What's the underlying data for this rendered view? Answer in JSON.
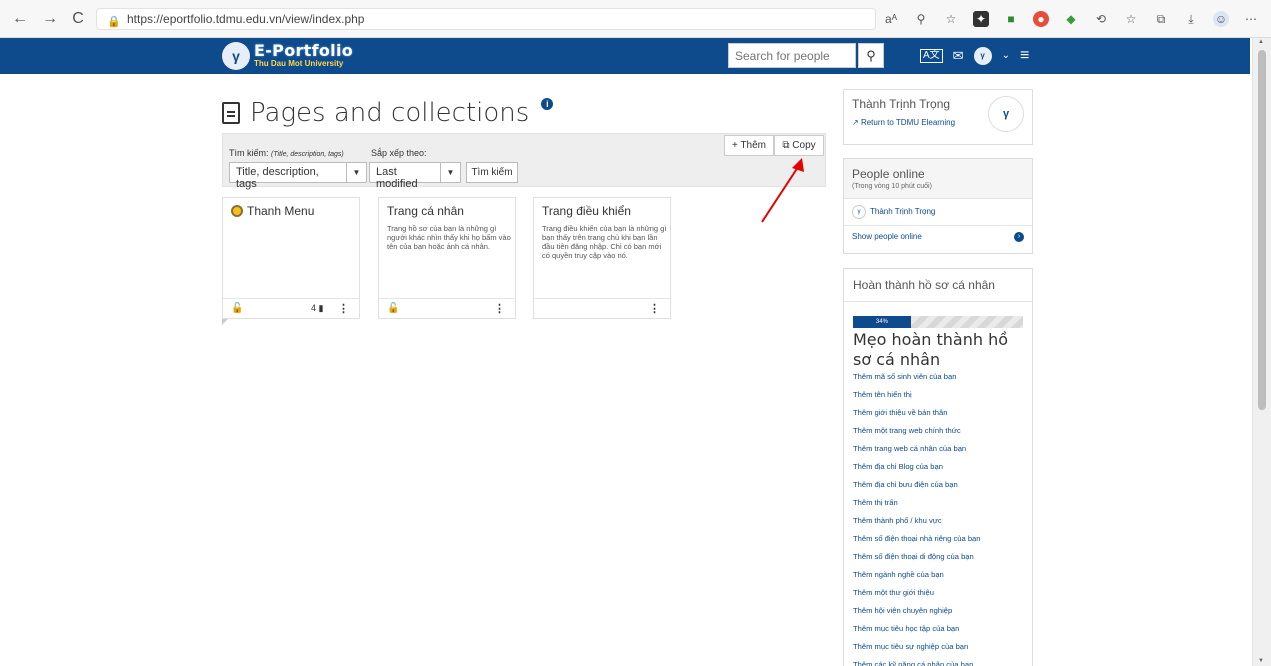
{
  "browser": {
    "url": "https://eportfolio.tdmu.edu.vn/view/index.php",
    "back": "←",
    "forward": "→",
    "reload": "C"
  },
  "header": {
    "logo_title": "E-Portfolio",
    "logo_subtitle": "Thu Dau Mot University",
    "search_placeholder": "Search for people",
    "search_icon": "search-icon"
  },
  "main": {
    "title": "Pages and collections",
    "filter": {
      "search_label": "Tìm kiếm:",
      "search_hint": "(Title, description, tags)",
      "sort_label": "Sắp xếp theo:",
      "search_select": "Title, description, tags",
      "sort_select": "Last modified",
      "find_button": "Tìm kiếm",
      "add_button": "+ Thêm",
      "copy_button": "Copy"
    },
    "cards": [
      {
        "title": "Thanh Menu",
        "description": "",
        "count": "4",
        "has_lock": true
      },
      {
        "title": "Trang cá nhân",
        "description": "Trang hồ sơ của bạn là những gì người khác nhìn thấy khi họ bấm vào tên của bạn hoặc ảnh cá nhân.",
        "count": "",
        "has_lock": true
      },
      {
        "title": "Trang điều khiển",
        "description": "Trang điều khiển của bạn là những gì bạn thấy trên trang chủ khi bạn lần đầu tiên đăng nhập. Chỉ có bạn mới có quyền truy cập vào nó.",
        "count": "",
        "has_lock": false
      }
    ]
  },
  "sidebar": {
    "user": {
      "name": "Thành Trịnh Trọng",
      "return_link": "Return to TDMU Elearning"
    },
    "online": {
      "title": "People online",
      "subtitle": "(Trong vòng 10 phút cuối)",
      "person": "Thành Trịnh Trọng",
      "show_link": "Show people online"
    },
    "profile": {
      "title": "Hoàn thành hồ sơ cá nhân",
      "progress_percent": 34,
      "progress_label": "34%",
      "tips_title": "Mẹo hoàn thành hồ sơ cá nhân",
      "tips": [
        "Thêm mã số sinh viên của bạn",
        "Thêm tên hiển thị",
        "Thêm giới thiệu về bản thân",
        "Thêm một trang web chính thức",
        "Thêm trang web cá nhân của bạn",
        "Thêm địa chỉ Blog của bạn",
        "Thêm địa chỉ bưu điện của bạn",
        "Thêm thị trấn",
        "Thêm thành phố / khu vực",
        "Thêm số điện thoại nhà riêng của bạn",
        "Thêm số điện thoại di động của bạn",
        "Thêm ngành nghề của bạn",
        "Thêm một thư giới thiệu",
        "Thêm hội viên chuyên nghiệp",
        "Thêm mục tiêu học tập của bạn",
        "Thêm mục tiêu sự nghiệp của bạn",
        "Thêm các kỹ năng cá nhân của bạn"
      ]
    }
  },
  "colors": {
    "brand": "#0d4b8c",
    "annotation": "#e60000"
  }
}
